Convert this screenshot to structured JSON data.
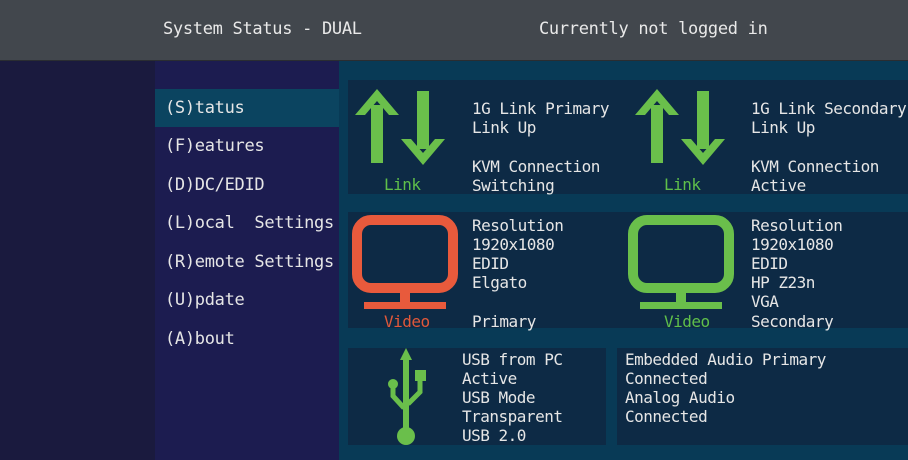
{
  "header": {
    "title": "System Status - DUAL",
    "login_status": "Currently not logged in"
  },
  "menu": [
    {
      "label": "(S)tatus",
      "active": true
    },
    {
      "label": "(F)eatures",
      "active": false
    },
    {
      "label": "(D)DC/EDID",
      "active": false
    },
    {
      "label": "(L)ocal  Settings",
      "active": false
    },
    {
      "label": "(R)emote Settings",
      "active": false
    },
    {
      "label": "(U)pdate",
      "active": false
    },
    {
      "label": "(A)bout",
      "active": false
    }
  ],
  "links": [
    {
      "icon": "link-arrows-icon",
      "icon_label": "Link",
      "line1": "1G Link Primary",
      "line2": "Link Up",
      "kvm_label": "KVM Connection",
      "kvm_state": "Switching",
      "color": "#6abf4b"
    },
    {
      "icon": "link-arrows-icon",
      "icon_label": "Link",
      "line1": "1G Link Secondary",
      "line2": "Link Up",
      "kvm_label": "KVM Connection",
      "kvm_state": "Active",
      "color": "#6abf4b"
    }
  ],
  "videos": [
    {
      "icon": "monitor-icon",
      "icon_label": "Video",
      "color": "#e85a3c",
      "lines": [
        "Resolution",
        "1920x1080",
        "EDID",
        "Elgato",
        "",
        "Primary"
      ]
    },
    {
      "icon": "monitor-icon",
      "icon_label": "Video",
      "color": "#6abf4b",
      "lines": [
        "Resolution",
        "1920x1080",
        "EDID",
        "HP Z23n",
        "VGA",
        "Secondary"
      ]
    }
  ],
  "usb": {
    "icon": "usb-icon",
    "color": "#6abf4b",
    "lines": [
      "USB from PC",
      "Active",
      "USB Mode",
      "Transparent",
      "USB 2.0"
    ]
  },
  "audio": {
    "lines": [
      "Embedded Audio Primary",
      "Connected",
      "Analog Audio",
      "Connected"
    ]
  }
}
